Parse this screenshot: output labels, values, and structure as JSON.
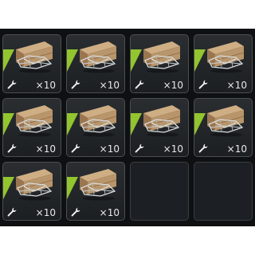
{
  "inventory": {
    "slots": [
      {
        "filled": true,
        "item_icon": "wooden-crate-with-glider-icon",
        "tool_icon": "wrench-icon",
        "count": "×10"
      },
      {
        "filled": true,
        "item_icon": "wooden-crate-with-glider-icon",
        "tool_icon": "wrench-icon",
        "count": "×10"
      },
      {
        "filled": true,
        "item_icon": "wooden-crate-with-glider-icon",
        "tool_icon": "wrench-icon",
        "count": "×10"
      },
      {
        "filled": true,
        "item_icon": "wooden-crate-with-glider-icon",
        "tool_icon": "wrench-icon",
        "count": "×10"
      },
      {
        "filled": true,
        "item_icon": "wooden-crate-with-glider-icon",
        "tool_icon": "wrench-icon",
        "count": "×10"
      },
      {
        "filled": true,
        "item_icon": "wooden-crate-with-glider-icon",
        "tool_icon": "wrench-icon",
        "count": "×10"
      },
      {
        "filled": true,
        "item_icon": "wooden-crate-with-glider-icon",
        "tool_icon": "wrench-icon",
        "count": "×10"
      },
      {
        "filled": true,
        "item_icon": "wooden-crate-with-glider-icon",
        "tool_icon": "wrench-icon",
        "count": "×10"
      },
      {
        "filled": true,
        "item_icon": "wooden-crate-with-glider-icon",
        "tool_icon": "wrench-icon",
        "count": "×10"
      },
      {
        "filled": true,
        "item_icon": "wooden-crate-with-glider-icon",
        "tool_icon": "wrench-icon",
        "count": "×10"
      },
      {
        "filled": false
      },
      {
        "filled": false
      }
    ],
    "colors": {
      "rarity_accent": "#7fc423",
      "crate_wood": "#b8956a",
      "background": "#0e1012"
    }
  }
}
